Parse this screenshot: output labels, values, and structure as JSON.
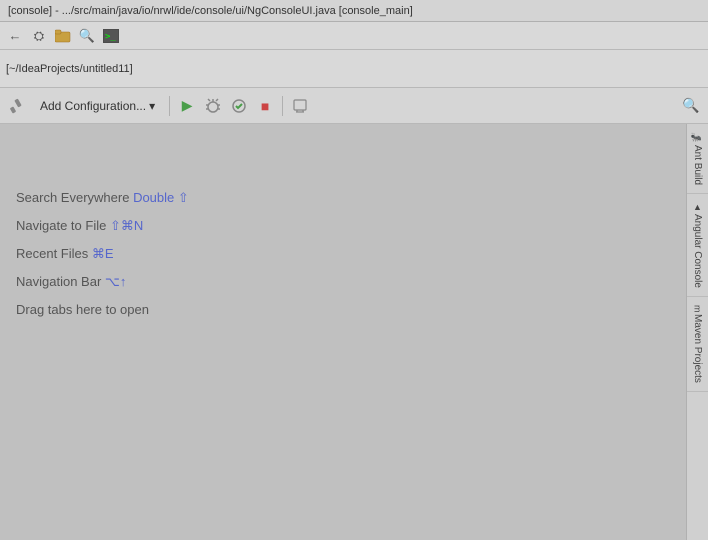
{
  "title_bar": {
    "text": "[console] - .../src/main/java/io/nrwl/ide/console/ui/NgConsoleUI.java [console_main]"
  },
  "toolbar1": {
    "icons": [
      "⚙",
      "🔧",
      "🔍",
      "📋"
    ]
  },
  "breadcrumb": {
    "text": "[~/IdeaProjects/untitled11]"
  },
  "run_toolbar": {
    "add_config_label": "Add Configuration...",
    "add_config_arrow": "▾",
    "search_icon": "🔍"
  },
  "hints": [
    {
      "prefix": "Search Everywhere",
      "shortcut": " Double ⇧"
    },
    {
      "prefix": "Navigate to File",
      "shortcut": " ⇧⌘N"
    },
    {
      "prefix": "Recent Files",
      "shortcut": " ⌘E"
    },
    {
      "prefix": "Navigation Bar",
      "shortcut": " ⌥↑"
    },
    {
      "prefix": "Drag tabs here to open",
      "shortcut": ""
    }
  ],
  "sidebar_tabs": [
    {
      "label": "Ant Build",
      "icon": "🐜"
    },
    {
      "label": "Angular Console",
      "icon": "▲"
    },
    {
      "label": "Maven Projects",
      "icon": "m"
    }
  ]
}
